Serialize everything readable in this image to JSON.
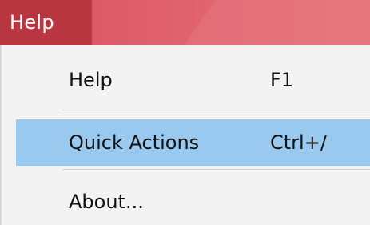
{
  "menubar": {
    "active_menu": "Help"
  },
  "dropdown": {
    "items": [
      {
        "label": "Help",
        "shortcut": "F1"
      },
      {
        "label": "Quick Actions",
        "shortcut": "Ctrl+/"
      },
      {
        "label": "About...",
        "shortcut": ""
      }
    ]
  },
  "colors": {
    "menubar_bg": "#e0616c",
    "active_menu_bg": "#b8363f",
    "highlight_bg": "#99c9ef"
  }
}
